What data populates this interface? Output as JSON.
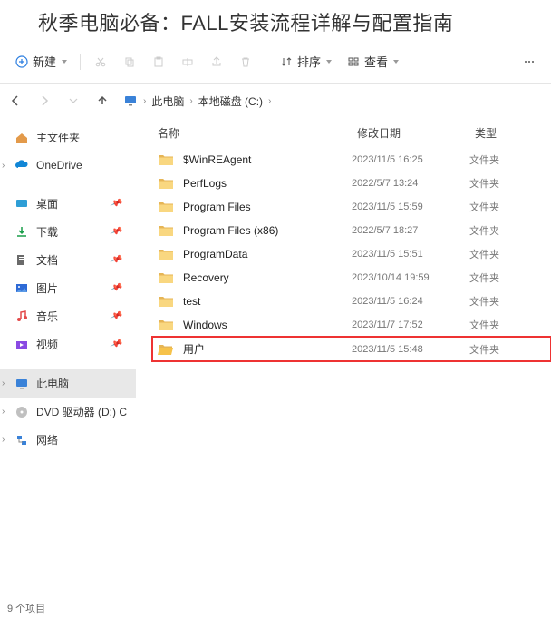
{
  "page_title": "秋季电脑必备：FALL安装流程详解与配置指南",
  "toolbar": {
    "new_label": "新建",
    "sort_label": "排序",
    "view_label": "查看"
  },
  "breadcrumb": {
    "root": "此电脑",
    "drive": "本地磁盘 (C:)"
  },
  "columns": {
    "name": "名称",
    "date": "修改日期",
    "type": "类型"
  },
  "sidebar": {
    "home": "主文件夹",
    "onedrive": "OneDrive",
    "quick": [
      {
        "label": "桌面"
      },
      {
        "label": "下载"
      },
      {
        "label": "文档"
      },
      {
        "label": "图片"
      },
      {
        "label": "音乐"
      },
      {
        "label": "视频"
      }
    ],
    "thispc": "此电脑",
    "dvd": "DVD 驱动器 (D:) C",
    "network": "网络"
  },
  "files": [
    {
      "name": "$WinREAgent",
      "date": "2023/11/5 16:25",
      "type": "文件夹",
      "hl": false
    },
    {
      "name": "PerfLogs",
      "date": "2022/5/7 13:24",
      "type": "文件夹",
      "hl": false
    },
    {
      "name": "Program Files",
      "date": "2023/11/5 15:59",
      "type": "文件夹",
      "hl": false
    },
    {
      "name": "Program Files (x86)",
      "date": "2022/5/7 18:27",
      "type": "文件夹",
      "hl": false
    },
    {
      "name": "ProgramData",
      "date": "2023/11/5 15:51",
      "type": "文件夹",
      "hl": false
    },
    {
      "name": "Recovery",
      "date": "2023/10/14 19:59",
      "type": "文件夹",
      "hl": false
    },
    {
      "name": "test",
      "date": "2023/11/5 16:24",
      "type": "文件夹",
      "hl": false
    },
    {
      "name": "Windows",
      "date": "2023/11/7 17:52",
      "type": "文件夹",
      "hl": false
    },
    {
      "name": "用户",
      "date": "2023/11/5 15:48",
      "type": "文件夹",
      "hl": true
    }
  ],
  "status": "9 个项目",
  "colors": {
    "highlight_border": "#e33",
    "folder_normal": "#f9d780",
    "folder_open": "#f6c24a"
  }
}
